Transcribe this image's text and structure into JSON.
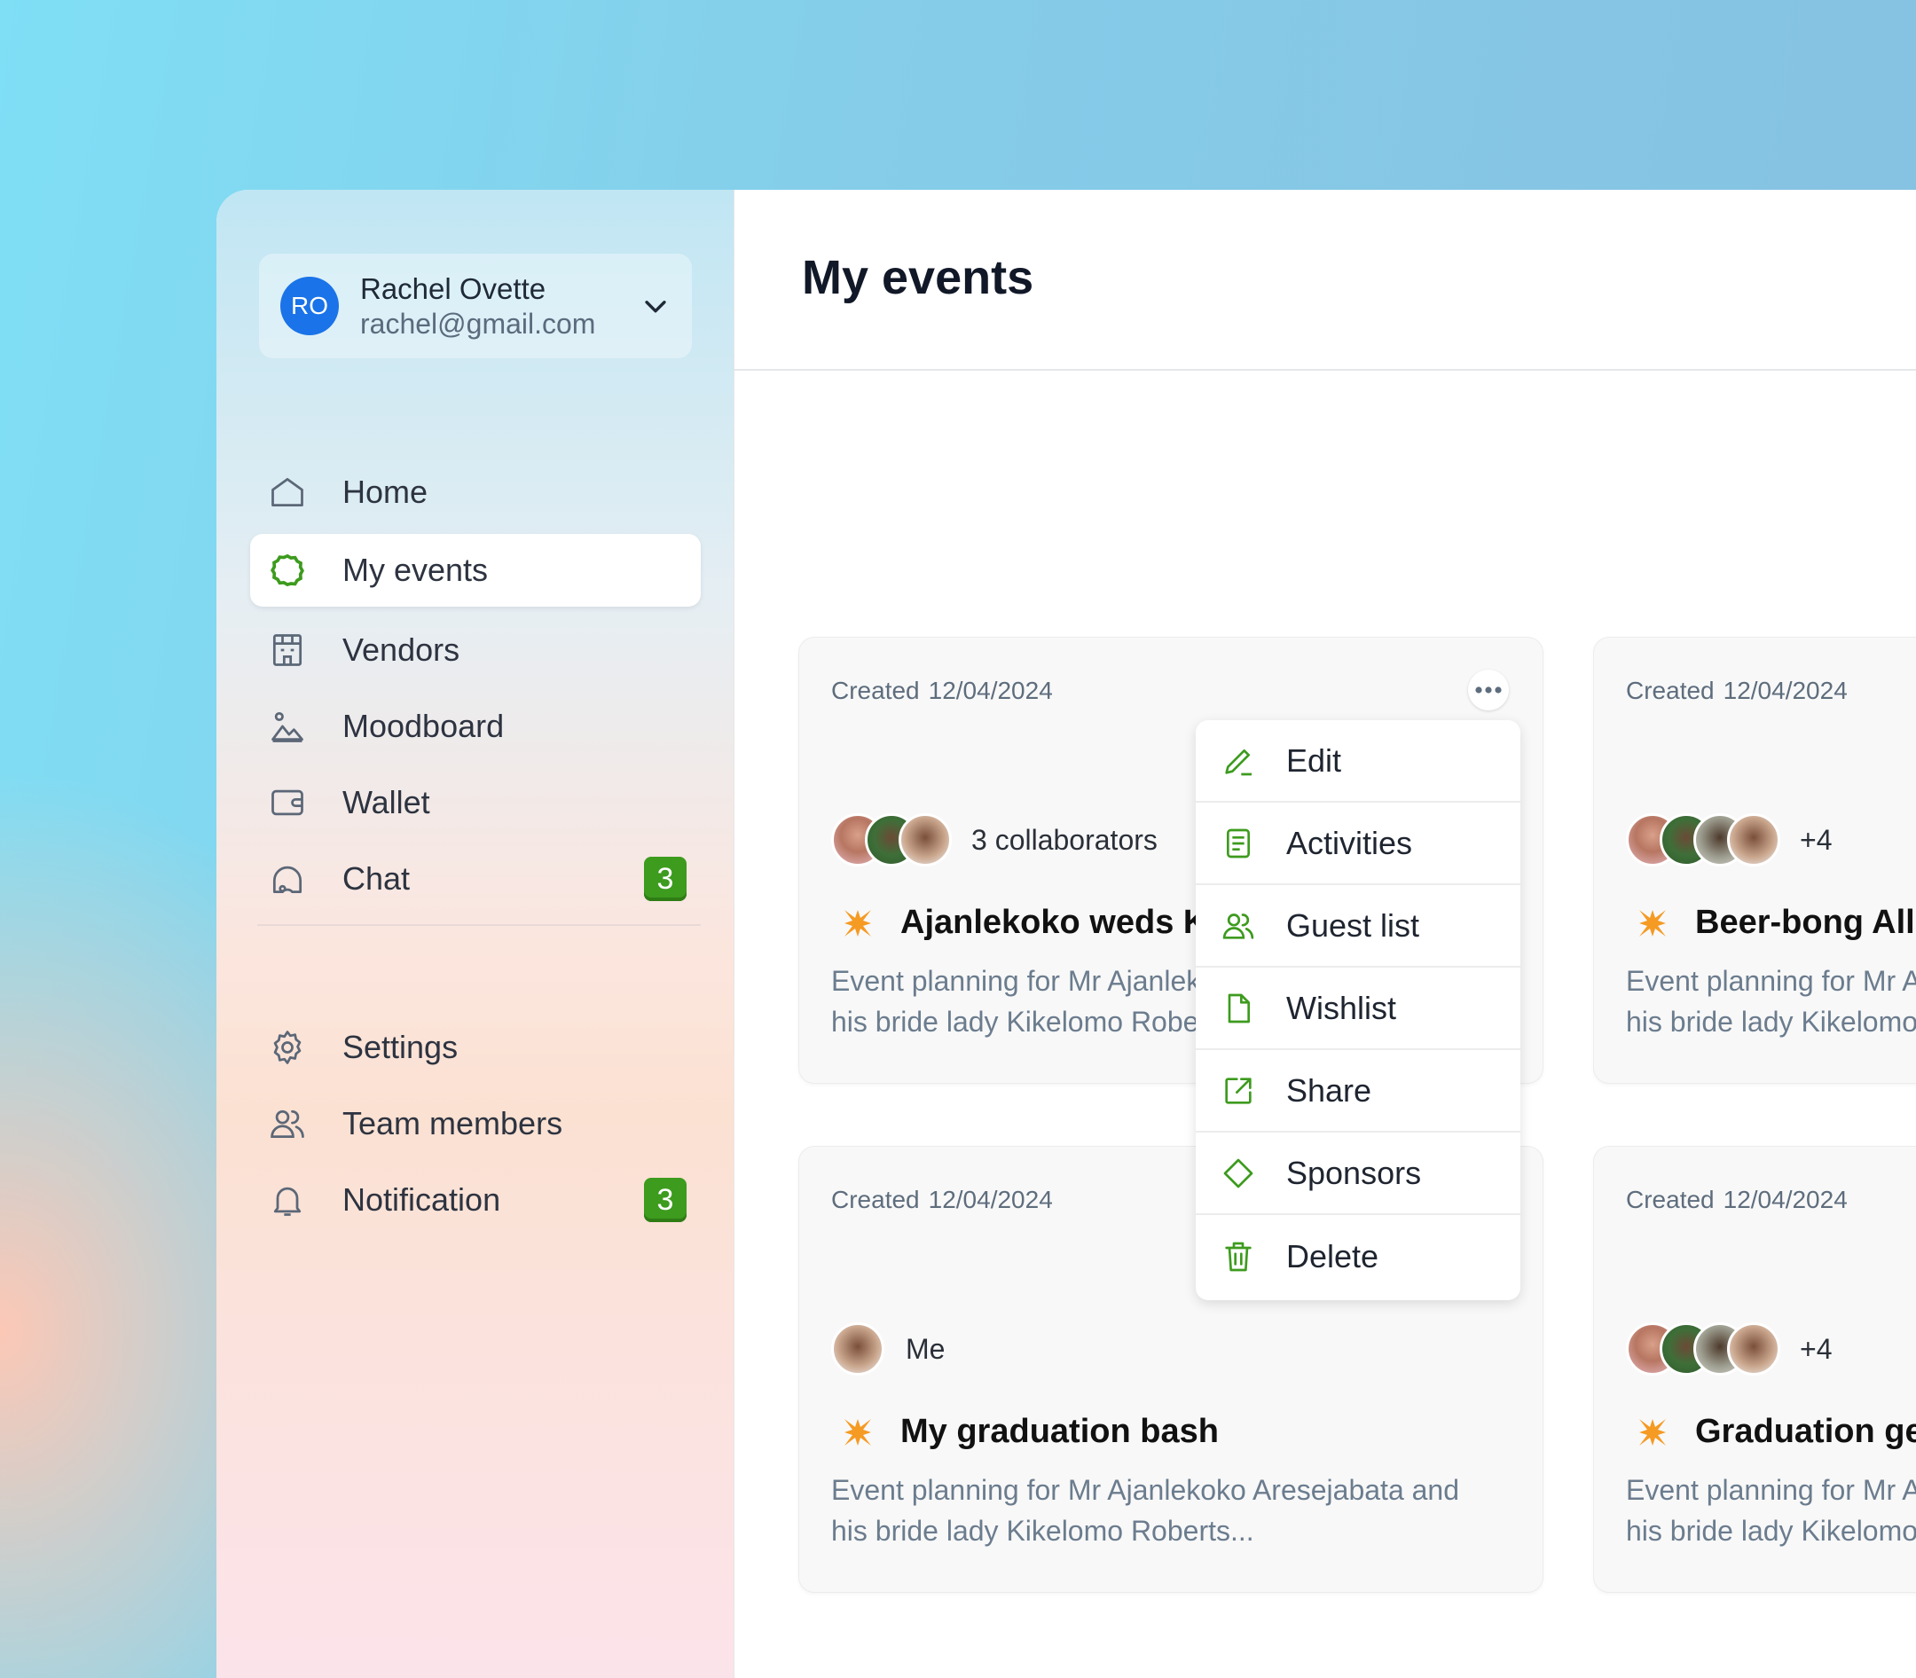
{
  "profile": {
    "initials": "RO",
    "name": "Rachel Ovette",
    "email": "rachel@gmail.com"
  },
  "nav": {
    "items": [
      {
        "label": "Home",
        "icon": "home-icon"
      },
      {
        "label": "My events",
        "icon": "events-icon",
        "active": true
      },
      {
        "label": "Vendors",
        "icon": "vendors-icon"
      },
      {
        "label": "Moodboard",
        "icon": "moodboard-icon"
      },
      {
        "label": "Wallet",
        "icon": "wallet-icon"
      },
      {
        "label": "Chat",
        "icon": "chat-icon",
        "badge": "3"
      }
    ],
    "bottom_items": [
      {
        "label": "Settings",
        "icon": "gear-icon"
      },
      {
        "label": "Team members",
        "icon": "team-icon"
      },
      {
        "label": "Notification",
        "icon": "bell-icon",
        "badge": "3"
      }
    ]
  },
  "page": {
    "title": "My events"
  },
  "cards": [
    {
      "created_label": "Created",
      "date": "12/04/2024",
      "collaborators": "3 collaborators",
      "title": "Ajanlekoko weds Kikelomo",
      "desc_line1": "Event planning for Mr Ajanlekoko Aresejabata and",
      "desc_line2": "his bride lady Kikelomo Roberts..."
    },
    {
      "created_label": "Created",
      "date": "12/04/2024",
      "collaborators": "+4",
      "title": "Beer-bong All Night",
      "desc_line1": "Event planning for Mr Ajanlekoko Aresejabata and",
      "desc_line2": "his bride lady Kikelomo Roberts..."
    },
    {
      "created_label": "Created",
      "date": "12/04/2024",
      "collaborators": "Me",
      "title": "My graduation bash",
      "desc_line1": "Event planning for Mr Ajanlekoko Aresejabata and",
      "desc_line2": "his bride lady Kikelomo Roberts..."
    },
    {
      "created_label": "Created",
      "date": "12/04/2024",
      "collaborators": "+4",
      "title": "Graduation get-together",
      "desc_line1": "Event planning for Mr Ajanlekoko Aresejabata and",
      "desc_line2": "his bride lady Kikelomo Roberts..."
    }
  ],
  "menu": {
    "items": [
      {
        "label": "Edit",
        "icon": "pencil-icon"
      },
      {
        "label": "Activities",
        "icon": "document-icon"
      },
      {
        "label": "Guest list",
        "icon": "users-icon"
      },
      {
        "label": "Wishlist",
        "icon": "file-icon"
      },
      {
        "label": "Share",
        "icon": "share-icon"
      },
      {
        "label": "Sponsors",
        "icon": "diamond-icon"
      },
      {
        "label": "Delete",
        "icon": "trash-icon"
      }
    ]
  },
  "colors": {
    "accent_green": "#3d9b1e",
    "avatar_blue": "#1a73e8",
    "star_orange": "#f59a23"
  }
}
